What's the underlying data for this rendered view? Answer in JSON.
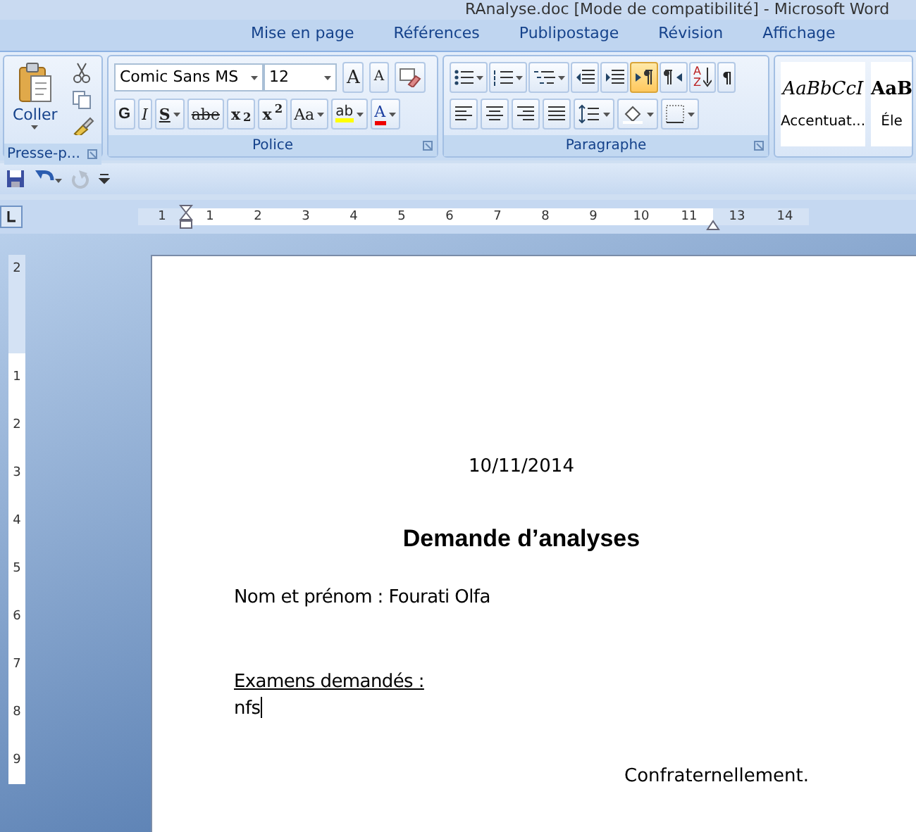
{
  "window": {
    "title": "RAnalyse.doc [Mode de compatibilité] - Microsoft Word"
  },
  "tabs": [
    {
      "label": "Mise en page",
      "selected": false
    },
    {
      "label": "Références",
      "selected": false
    },
    {
      "label": "Publipostage",
      "selected": false
    },
    {
      "label": "Révision",
      "selected": false
    },
    {
      "label": "Affichage",
      "selected": false
    }
  ],
  "clipboard": {
    "paste": "Coller",
    "group_label": "Presse-p..."
  },
  "font": {
    "family": "Comic Sans MS",
    "size": "12",
    "group_label": "Police",
    "size_buttons": [
      {
        "kind": "grow",
        "text": "A"
      },
      {
        "kind": "shrink",
        "text": "A"
      }
    ],
    "format_buttons": [
      {
        "kind": "bold",
        "text": "G"
      },
      {
        "kind": "italic",
        "text": "I"
      },
      {
        "kind": "underline",
        "text": "S"
      },
      {
        "kind": "strike",
        "text": "abe"
      },
      {
        "kind": "sub",
        "text": "x$_{2}$"
      },
      {
        "kind": "sup",
        "text": "x$^{2}$"
      },
      {
        "kind": "case",
        "text": "Aa"
      }
    ],
    "highlight": "ab",
    "color_letter": "A"
  },
  "paragraph": {
    "group_label": "Paragraphe",
    "top_buttons": [
      {
        "kind": "bullets",
        "selected": false
      },
      {
        "kind": "numbering",
        "selected": false
      },
      {
        "kind": "multilevel",
        "selected": false
      },
      {
        "kind": "outdent",
        "selected": false
      },
      {
        "kind": "indent",
        "selected": false
      },
      {
        "kind": "ltr",
        "selected": true
      },
      {
        "kind": "rtl",
        "selected": false
      },
      {
        "kind": "sort",
        "selected": false
      },
      {
        "kind": "pilcrow",
        "selected": false
      }
    ],
    "sort_letters": [
      "A",
      "Z"
    ],
    "pilcrow": "¶",
    "bottom_buttons": [
      {
        "kind": "left",
        "selected": false
      },
      {
        "kind": "center",
        "selected": false
      },
      {
        "kind": "right",
        "selected": false
      },
      {
        "kind": "justify",
        "selected": false
      },
      {
        "kind": "spacing",
        "selected": false
      },
      {
        "kind": "shading",
        "selected": false
      },
      {
        "kind": "borders",
        "selected": false
      }
    ]
  },
  "styles": [
    {
      "sample": "AaBbCcI",
      "label": "Accentuat...",
      "kind": "italic"
    },
    {
      "sample": "AaB",
      "label": "Éle",
      "kind": "bold"
    }
  ],
  "quick_access": {
    "redo_disabled": true
  },
  "horizontal_ruler": [
    {
      "kind": "number",
      "label": "1",
      "margin": true
    },
    {
      "kind": "left-indent"
    },
    {
      "kind": "number",
      "label": "1",
      "margin": false
    },
    {
      "kind": "number",
      "label": "2",
      "margin": false
    },
    {
      "kind": "number",
      "label": "3",
      "margin": false
    },
    {
      "kind": "number",
      "label": "4",
      "margin": false
    },
    {
      "kind": "number",
      "label": "5",
      "margin": false
    },
    {
      "kind": "number",
      "label": "6",
      "margin": false
    },
    {
      "kind": "number",
      "label": "7",
      "margin": false
    },
    {
      "kind": "number",
      "label": "8",
      "margin": false
    },
    {
      "kind": "number",
      "label": "9",
      "margin": false
    },
    {
      "kind": "number",
      "label": "10",
      "margin": false
    },
    {
      "kind": "number",
      "label": "11",
      "margin": false
    },
    {
      "kind": "right-indent"
    },
    {
      "kind": "number",
      "label": "13",
      "margin": true
    },
    {
      "kind": "number",
      "label": "14",
      "margin": true
    }
  ],
  "vertical_ruler": [
    {
      "label": "2",
      "margin": true
    },
    {
      "label": "1",
      "margin": false
    },
    {
      "label": "2",
      "margin": false
    },
    {
      "label": "3",
      "margin": false
    },
    {
      "label": "4",
      "margin": false
    },
    {
      "label": "5",
      "margin": false
    },
    {
      "label": "6",
      "margin": false
    },
    {
      "label": "7",
      "margin": false
    },
    {
      "label": "8",
      "margin": false
    },
    {
      "label": "9",
      "margin": false
    }
  ],
  "document": [
    {
      "kind": "date",
      "text": "10/11/2014",
      "cursor": false
    },
    {
      "kind": "heading",
      "text": "Demande d’analyses",
      "cursor": false
    },
    {
      "kind": "line",
      "text": "Nom et prénom : Fourati Olfa",
      "cursor": false
    },
    {
      "kind": "underlined",
      "text": "Examens demandés :",
      "cursor": false
    },
    {
      "kind": "line",
      "text": "nfs",
      "cursor": true
    },
    {
      "kind": "closing",
      "text": "Confraternellement.",
      "cursor": false
    }
  ]
}
